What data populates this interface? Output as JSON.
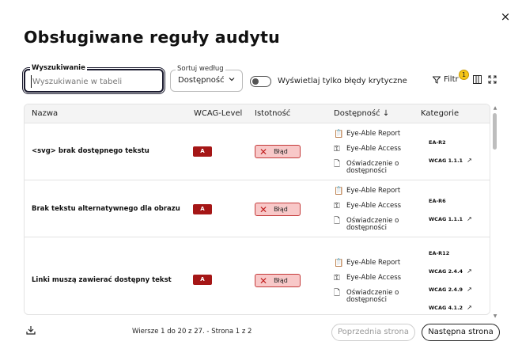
{
  "dialog": {
    "title": "Obsługiwane reguły audytu",
    "close_icon": "×"
  },
  "search": {
    "label": "Wyszukiwanie",
    "placeholder": "Wyszukiwanie w tabeli",
    "value": ""
  },
  "sort": {
    "label": "Sortuj według",
    "value": "Dostępność"
  },
  "toggle": {
    "label": "Wyświetlaj tylko błędy krytyczne",
    "checked": false
  },
  "toolbar": {
    "filter_label": "Filtr",
    "filter_count": "1",
    "icons": [
      "filter-icon",
      "columns-icon",
      "fullscreen-icon"
    ]
  },
  "table": {
    "headers": {
      "name": "Nazwa",
      "wcag": "WCAG-Level",
      "severity": "Istotność",
      "access": "Dostępność",
      "access_sort": "↓",
      "categories": "Kategorie"
    },
    "rows": [
      {
        "name": "<svg> brak dostępnego tekstu",
        "wcag": "A",
        "severity": "Błąd",
        "access": [
          "Eye-Able Report",
          "Eye-Able Access",
          "Oświadczenie o dostępności"
        ],
        "categories": [
          {
            "label": "EA-R2",
            "link": false
          },
          {
            "label": "WCAG 1.1.1",
            "link": true
          }
        ]
      },
      {
        "name": "Brak tekstu alternatywnego dla obrazu",
        "wcag": "A",
        "severity": "Błąd",
        "access": [
          "Eye-Able Report",
          "Eye-Able Access",
          "Oświadczenie o dostępności"
        ],
        "categories": [
          {
            "label": "EA-R6",
            "link": false
          },
          {
            "label": "WCAG 1.1.1",
            "link": true
          }
        ]
      },
      {
        "name": "Linki muszą zawierać dostępny tekst",
        "wcag": "A",
        "severity": "Błąd",
        "access": [
          "Eye-Able Report",
          "Eye-Able Access",
          "Oświadczenie o dostępności"
        ],
        "categories": [
          {
            "label": "EA-R12",
            "link": false
          },
          {
            "label": "WCAG 2.4.4",
            "link": true
          },
          {
            "label": "WCAG 2.4.9",
            "link": true
          },
          {
            "label": "WCAG 4.1.2",
            "link": true
          }
        ]
      }
    ]
  },
  "footer": {
    "page_info": "Wiersze 1 do 20 z 27. - Strona 1 z 2",
    "prev_label": "Poprzednia strona",
    "next_label": "Następna strona"
  },
  "colors": {
    "wcag_badge": "#a51616",
    "severity_bg": "#f8c8c8",
    "severity_border": "#c43a3a",
    "filter_badge": "#f5c518"
  }
}
